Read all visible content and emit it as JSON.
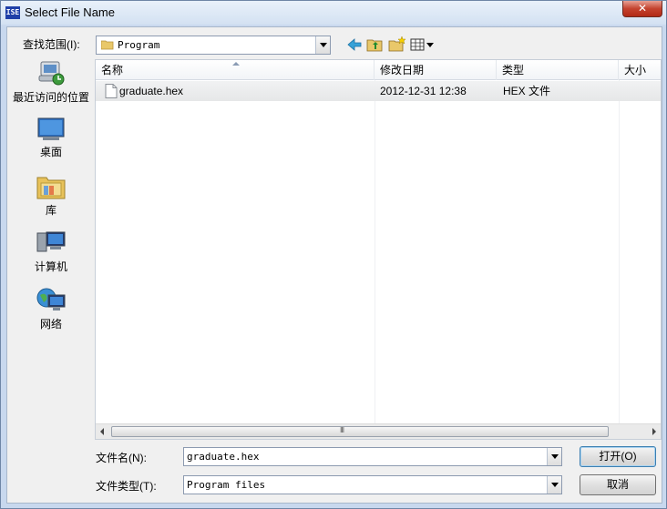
{
  "window": {
    "title": "Select File Name",
    "app_icon_text": "ISE",
    "close_symbol": "✕"
  },
  "toolbar": {
    "look_in_label": "查找范围(I):",
    "look_in_value": "Program"
  },
  "places": [
    {
      "name": "place-recent",
      "label": "最近访问的位置",
      "icon": "recent-places-icon"
    },
    {
      "name": "place-desktop",
      "label": "桌面",
      "icon": "desktop-icon"
    },
    {
      "name": "place-libraries",
      "label": "库",
      "icon": "libraries-icon"
    },
    {
      "name": "place-computer",
      "label": "计算机",
      "icon": "computer-icon"
    },
    {
      "name": "place-network",
      "label": "网络",
      "icon": "network-icon"
    }
  ],
  "columns": {
    "name": "名称",
    "date": "修改日期",
    "type": "类型",
    "size": "大小"
  },
  "files": [
    {
      "name": "graduate.hex",
      "date": "2012-12-31 12:38",
      "type": "HEX 文件",
      "size": ""
    }
  ],
  "footer": {
    "filename_label": "文件名(N):",
    "filename_value": "graduate.hex",
    "filetype_label": "文件类型(T):",
    "filetype_value": "Program files",
    "open_label": "打开(O)",
    "cancel_label": "取消"
  },
  "scrollbar": {
    "grip": "III"
  }
}
